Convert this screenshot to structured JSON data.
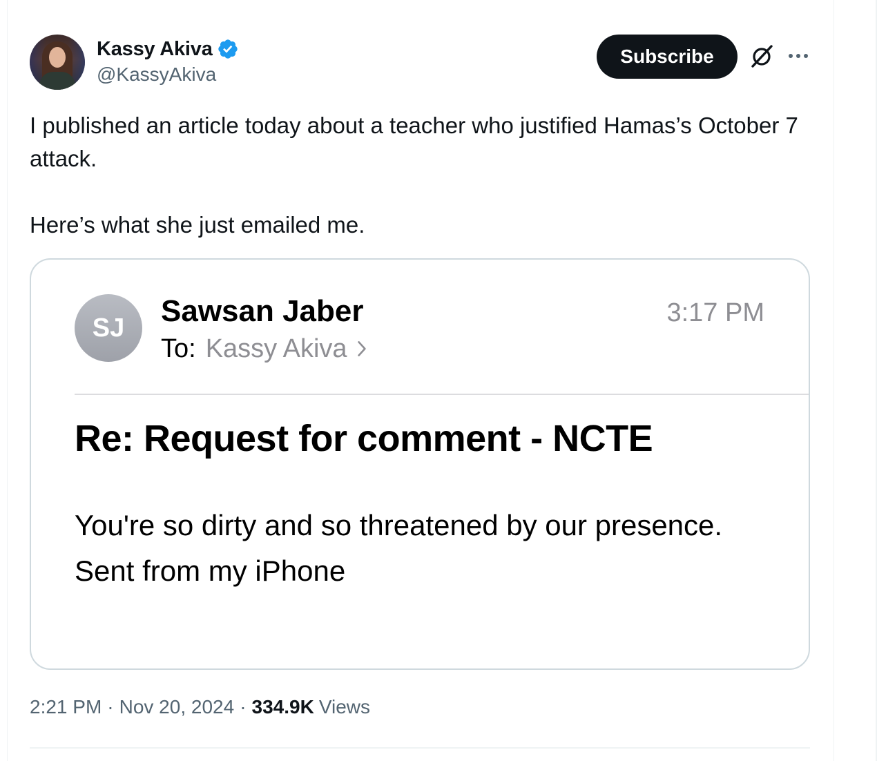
{
  "author": {
    "display_name": "Kassy Akiva",
    "handle": "@KassyAkiva",
    "verified": true,
    "verified_color": "#1d9bf0"
  },
  "actions": {
    "subscribe_label": "Subscribe",
    "grok_icon": "grok-icon",
    "more_icon": "more-icon"
  },
  "tweet": {
    "lines": [
      "I published an article today about a teacher who justified Hamas’s October 7 attack.",
      "Here’s what she just emailed me."
    ]
  },
  "email": {
    "sender_initials": "SJ",
    "sender_name": "Sawsan Jaber",
    "to_label": "To:",
    "to_name": "Kassy Akiva",
    "time": "3:17 PM",
    "subject": "Re: Request for comment - NCTE",
    "body_line1": "You're so dirty and so threatened by our presence.",
    "body_line2": "Sent from my iPhone"
  },
  "meta": {
    "time": "2:21 PM",
    "date": "Nov 20, 2024",
    "separator": "·",
    "views_count": "334.9K",
    "views_label": "Views"
  }
}
